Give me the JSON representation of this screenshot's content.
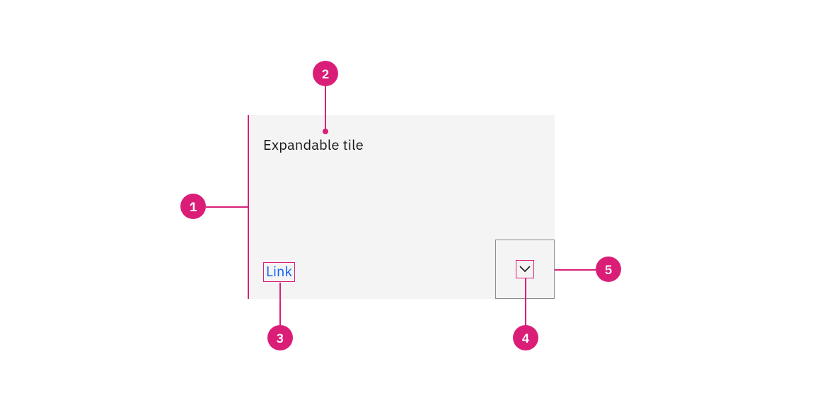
{
  "tile": {
    "title": "Expandable tile",
    "link_label": "Link"
  },
  "annotations": {
    "a1": "1",
    "a2": "2",
    "a3": "3",
    "a4": "4",
    "a5": "5"
  },
  "colors": {
    "accent": "#da1e78",
    "link": "#0f62fe",
    "tile_bg": "#f4f4f4",
    "border": "#8d8d8d",
    "text": "#161616"
  }
}
